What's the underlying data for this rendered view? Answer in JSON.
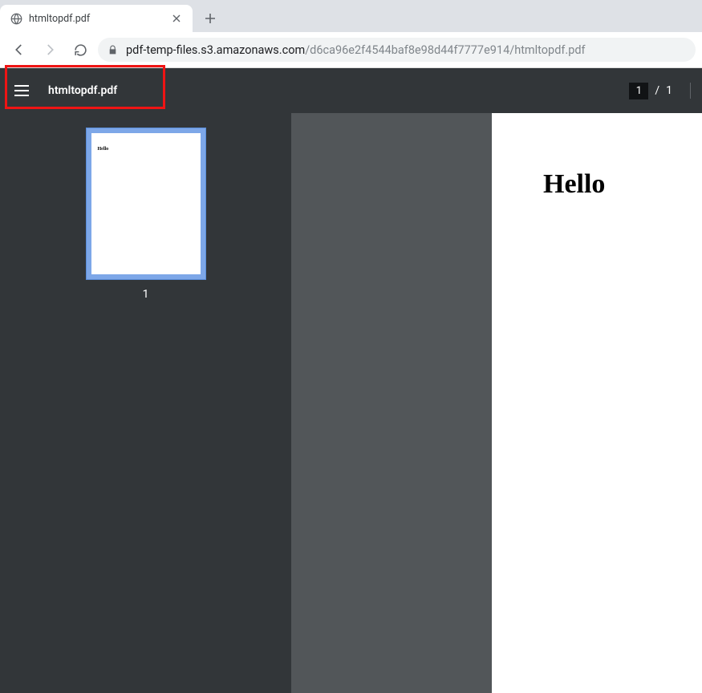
{
  "browser": {
    "tab_title": "htmltopdf.pdf",
    "url_host": "pdf-temp-files.s3.amazonaws.com",
    "url_path": "/d6ca96e2f4544baf8e98d44f7777e914/htmltopdf.pdf"
  },
  "viewer": {
    "title": "htmltopdf.pdf",
    "current_page": "1",
    "total_pages": "1",
    "page_separator": "/"
  },
  "thumbnails": {
    "items": [
      {
        "label": "1",
        "preview_text": "Hello"
      }
    ]
  },
  "document": {
    "heading": "Hello"
  }
}
